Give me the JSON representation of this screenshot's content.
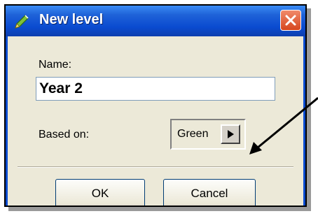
{
  "dialog": {
    "title": "New level",
    "name_label": "Name:",
    "name_value": "Year 2",
    "based_on_label": "Based on:",
    "based_on_value": "Green",
    "ok_label": "OK",
    "cancel_label": "Cancel"
  },
  "icons": {
    "app": "pen-icon",
    "close": "close-icon",
    "dropdown": "play-arrow-icon",
    "annotation": "pointer-arrow"
  },
  "colors": {
    "titlebar": "#0a4bd0",
    "close_button": "#d6461e",
    "dialog_face": "#ece9d8"
  }
}
